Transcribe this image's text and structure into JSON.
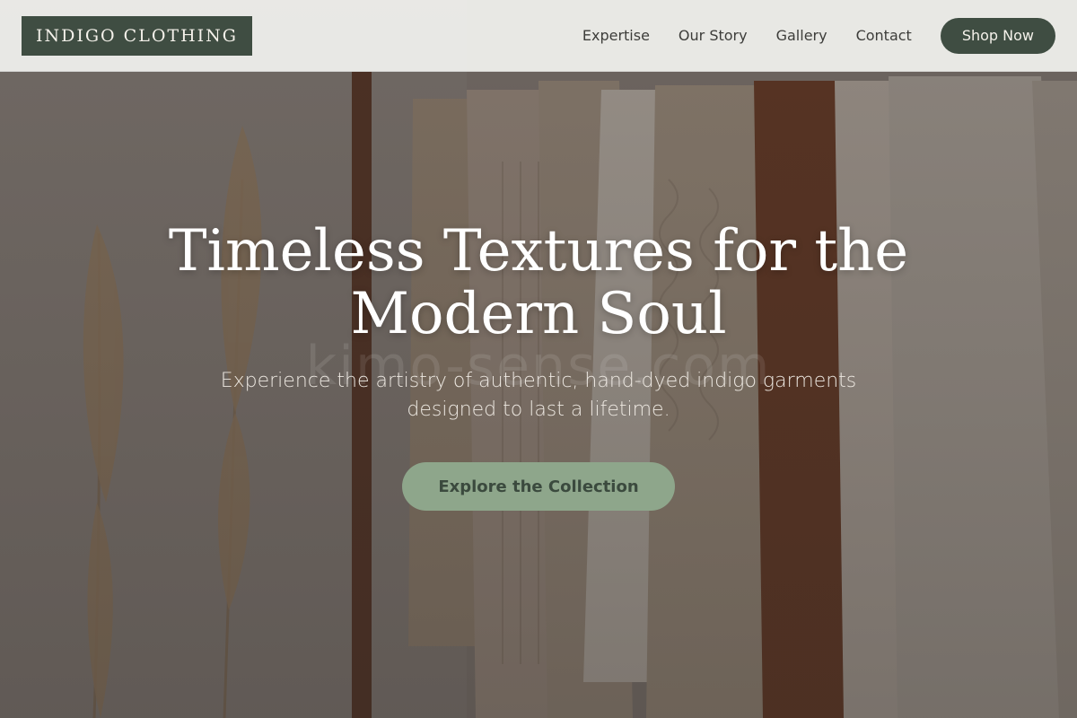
{
  "header": {
    "logo_text": "INDIGO CLOTHING",
    "nav": [
      {
        "label": "Expertise"
      },
      {
        "label": "Our Story"
      },
      {
        "label": "Gallery"
      },
      {
        "label": "Contact"
      }
    ],
    "shop_button": "Shop Now"
  },
  "hero": {
    "title": "Timeless Textures for the Modern Soul",
    "subtitle": "Experience the artistry of authentic, hand-dyed indigo garments designed to last a lifetime.",
    "cta_label": "Explore the Collection",
    "watermark": "kimo-sense.com"
  },
  "colors": {
    "brand_dark_green": "#3f4d42",
    "cta_sage": "#8ea68b",
    "header_bg": "#f0f0ed"
  }
}
